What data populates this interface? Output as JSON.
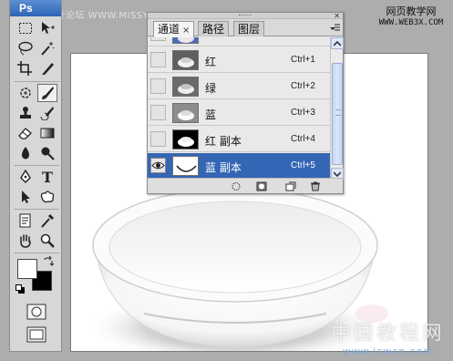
{
  "app": {
    "logo": "Ps"
  },
  "watermarks": {
    "top_left": "思缘设计论坛 WWW.MISSYUAN.COM",
    "top_right_line1": "网页教学网",
    "top_right_line2": "WWW.WEB3X.COM",
    "bottom_right_line1": "中国教程网",
    "bottom_right_line2": "www.jcwcn.com"
  },
  "toolbox": {
    "tools": [
      [
        "marquee-icon",
        "move-icon"
      ],
      [
        "lasso-icon",
        "magic-wand-icon"
      ],
      [
        "crop-icon",
        "slice-icon"
      ],
      [
        "healing-brush-icon",
        "brush-icon"
      ],
      [
        "clone-stamp-icon",
        "history-brush-icon"
      ],
      [
        "eraser-icon",
        "gradient-icon"
      ],
      [
        "blur-icon",
        "dodge-icon"
      ],
      [
        "pen-icon",
        "type-icon"
      ],
      [
        "path-selection-icon",
        "custom-shape-icon"
      ],
      [
        "notes-icon",
        "eyedropper-icon"
      ],
      [
        "hand-icon",
        "zoom-icon"
      ]
    ],
    "active_tool": "brush-icon",
    "foreground_color": "#ffffff",
    "background_color": "#000000"
  },
  "panel": {
    "tabs": [
      {
        "label": "通道",
        "active": true,
        "close": "×"
      },
      {
        "label": "路径",
        "active": false
      },
      {
        "label": "图层",
        "active": false
      }
    ],
    "channels": [
      {
        "name": "",
        "shortcut": "",
        "visible": false,
        "selected": false,
        "thumb": "rgb"
      },
      {
        "name": "红",
        "shortcut": "Ctrl+1",
        "visible": false,
        "selected": false,
        "thumb": "red"
      },
      {
        "name": "绿",
        "shortcut": "Ctrl+2",
        "visible": false,
        "selected": false,
        "thumb": "green"
      },
      {
        "name": "蓝",
        "shortcut": "Ctrl+3",
        "visible": false,
        "selected": false,
        "thumb": "blue"
      },
      {
        "name": "红 副本",
        "shortcut": "Ctrl+4",
        "visible": false,
        "selected": false,
        "thumb": "red-copy"
      },
      {
        "name": "蓝 副本",
        "shortcut": "Ctrl+5",
        "visible": true,
        "selected": true,
        "thumb": "blue-copy"
      }
    ],
    "footer_buttons": [
      "load-selection-icon",
      "save-selection-icon",
      "new-channel-icon",
      "delete-channel-icon"
    ]
  }
}
